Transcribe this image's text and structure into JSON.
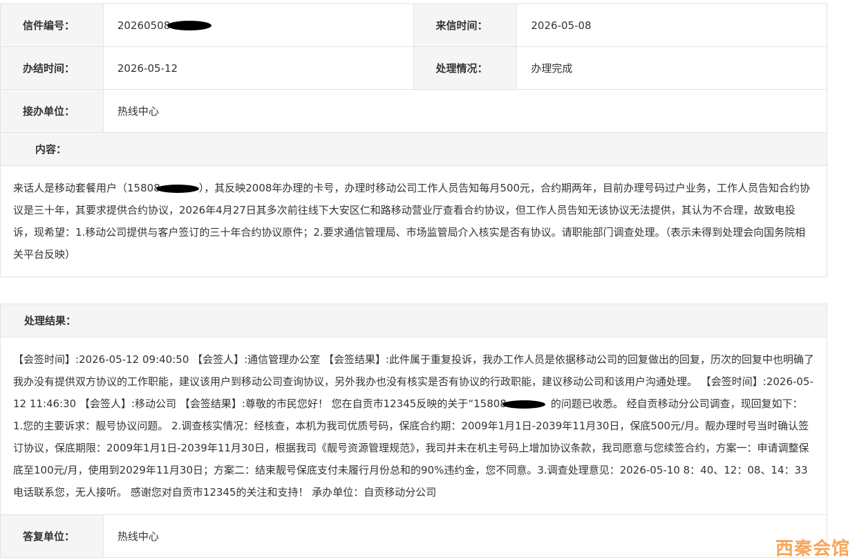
{
  "info": {
    "letter_no_label": "信件编号：",
    "letter_no_value": "20260508",
    "received_label": "来信时间：",
    "received_value": "2026-05-08",
    "closed_label": "办结时间：",
    "closed_value": "2026-05-12",
    "status_label": "处理情况：",
    "status_value": "办理完成",
    "handler_label": "接办单位：",
    "handler_value": "热线中心"
  },
  "content": {
    "header": "内容：",
    "phone_prefix": "15808",
    "text_before": "来话人是移动套餐用户（",
    "text_after": "），其反映2008年办理的卡号，办理时移动公司工作人员告知每月500元，合约期两年，目前办理号码过户业务，工作人员告知合约协议是三十年，其要求提供合约协议，2026年4月27日其多次前往线下大安区仁和路移动营业厅查看合约协议，但工作人员告知无该协议无法提供，其认为不合理，故致电投诉，现希望：1.移动公司提供与客户签订的三十年合约协议原件；2.要求通信管理局、市场监管局介入核实是否有协议。请职能部门调查处理。（表示未得到处理会向国务院相关平台反映）"
  },
  "result": {
    "header": "处理结果：",
    "text_before": "【会签时间】:2026-05-12 09:40:50 【会签人】:通信管理办公室 【会签结果】:此件属于重复投诉，我办工作人员是依据移动公司的回复做出的回复，历次的回复中也明确了我办没有提供双方协议的工作职能，建议该用户到移动公司查询协议，另外我办也没有核实是否有协议的行政职能，建议移动公司和该用户沟通处理。 【会签时间】:2026-05-12 11:46:30 【会签人】:移动公司 【会签结果】:尊敬的市民您好！ 您在自贡市12345反映的关于“",
    "phone_prefix": "15808",
    "text_after": "的问题已收悉。 经自贡移动分公司调查，现回复如下： 1.您的主要诉求：靓号协议问题。 2.调查核实情况：经核查，本机为我司优质号码，保底合约期：2009年1月1日-2039年11月30日，保底500元/月。靓办理时号当时确认签订协议，保底期限：2009年1月1日-2039年11月30日，根据我司《靓号资源管理规范》，我司并未在机主号码上增加协议条款，我司愿意与您续签合约，方案一：申请调整保底至100元/月，使用到2029年11月30日；方案二：结束靓号保底支付未履行月份总和的90%违约金，您不同意。3.调查处理意见：2026-05-10 8：40、12：08、14：33电话联系您，无人接听。 感谢您对自贡市12345的关注和支持！ 承办单位：自贡移动分公司"
  },
  "reply": {
    "label": "答复单位：",
    "value": "热线中心"
  },
  "watermark": "西秦会馆"
}
